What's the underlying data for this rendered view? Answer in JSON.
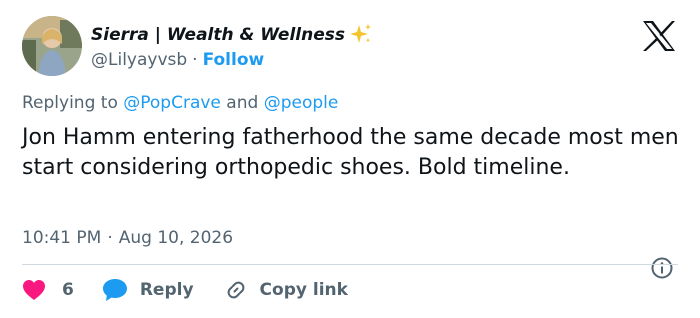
{
  "author": {
    "display_name": "Sierra | Wealth & Wellness",
    "handle": "@Lilyayvsb",
    "separator": "·",
    "follow_label": "Follow"
  },
  "reply_context": {
    "prefix": "Replying to ",
    "mention_1": "@PopCrave",
    "conjunction": " and ",
    "mention_2": "@people"
  },
  "tweet": {
    "text": "Jon Hamm entering fatherhood the same decade most men start considering orthopedic shoes. Bold timeline."
  },
  "meta": {
    "time": "10:41 PM",
    "separator": "·",
    "date": "Aug 10, 2026"
  },
  "actions": {
    "like_count": "6",
    "reply_label": "Reply",
    "copy_link_label": "Copy link"
  },
  "icons": {
    "brand": "x-logo-icon",
    "sparkle": "sparkles-icon",
    "info": "info-icon",
    "like": "heart-icon",
    "reply": "speech-bubble-icon",
    "copy": "link-icon"
  },
  "colors": {
    "accent": "#1d9bf0",
    "secondary_text": "#536471",
    "primary_text": "#0f1419",
    "like": "#f91880",
    "divider": "#cfd9de",
    "sparkle": "#f4c430"
  }
}
